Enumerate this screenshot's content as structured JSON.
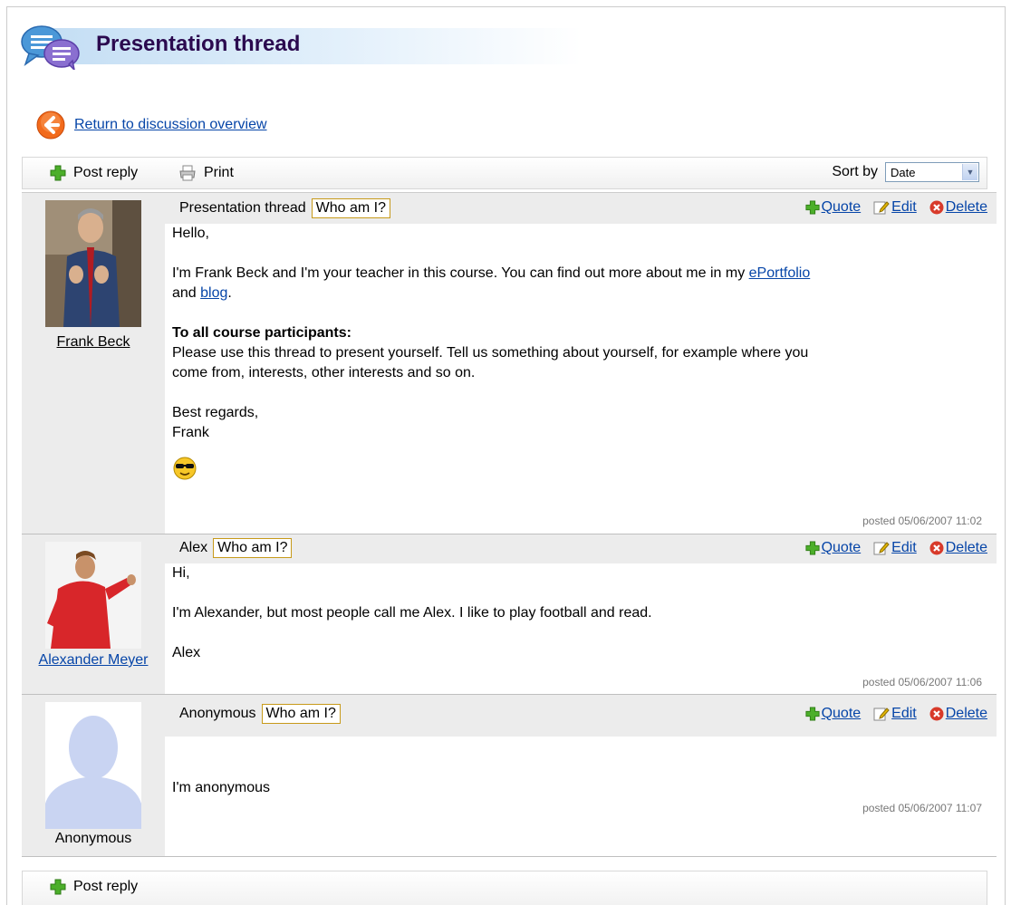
{
  "page": {
    "title": "Presentation thread",
    "return_link": "Return to discussion overview"
  },
  "toolbar": {
    "post_reply": "Post reply",
    "print": "Print",
    "sort_label": "Sort by",
    "sort_value": "Date"
  },
  "posts": [
    {
      "subject": "Presentation thread",
      "who_am_i": "Who am I?",
      "author": "Frank Beck",
      "quote": "Quote",
      "edit": "Edit",
      "delete": "Delete",
      "lines": {
        "l1": "Hello,",
        "l2a": "I'm Frank Beck and I'm your teacher in this course. You can find out more about me in my ",
        "l2link1": "ePortfolio",
        "l3a": "and ",
        "l3link2": "blog",
        "l3b": ".",
        "l4": "To all course participants:",
        "l5": "Please use this thread to present yourself. Tell us something about yourself, for example where you",
        "l6": "come from, interests, other interests and so on.",
        "l7": "Best regards,",
        "l8": "Frank"
      },
      "posted": "posted 05/06/2007 11:02"
    },
    {
      "subject": "Alex",
      "who_am_i": "Who am I?",
      "author": "Alexander Meyer",
      "quote": "Quote",
      "edit": "Edit",
      "delete": "Delete",
      "lines": {
        "l1": "Hi,",
        "l2": "I'm Alexander, but most people call me Alex. I like to play football and read.",
        "l3": "Alex"
      },
      "posted": "posted 05/06/2007 11:06"
    },
    {
      "subject": "Anonymous",
      "who_am_i": "Who am I?",
      "author": "Anonymous",
      "quote": "Quote",
      "edit": "Edit",
      "delete": "Delete",
      "lines": {
        "l1": "I'm anonymous"
      },
      "posted": "posted 05/06/2007 11:07"
    }
  ],
  "footer": {
    "post_reply": "Post reply"
  }
}
